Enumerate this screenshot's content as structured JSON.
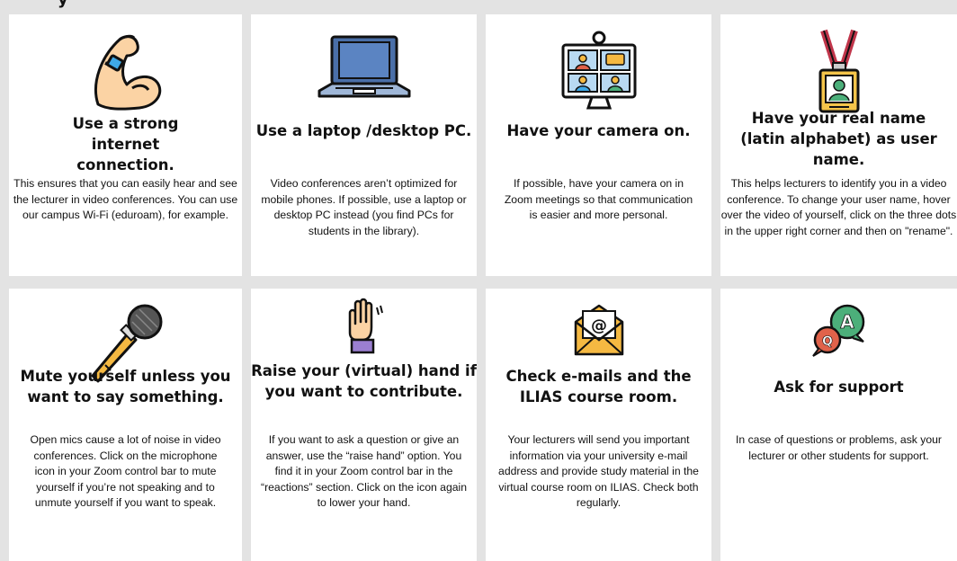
{
  "header": {
    "fragment": "y"
  },
  "cards": [
    {
      "title": "Use a strong internet connection.",
      "body": "This ensures that you can easily hear and see the lecturer in video conferences. You can use our campus Wi-Fi (eduroam), for example.",
      "icon": "flexed-arm-icon"
    },
    {
      "title": "Use a laptop /desktop PC.",
      "body": "Video conferences aren’t optimized for mobile phones. If possible, use a laptop or desktop PC instead (you find PCs for students in the library).",
      "icon": "laptop-icon"
    },
    {
      "title": "Have your camera on.",
      "body": "If possible, have your camera on in Zoom meetings so that communication is easier and more personal.",
      "icon": "video-conference-monitor-icon"
    },
    {
      "title": "Have your real name (latin alphabet) as user name.",
      "body": "This helps lecturers to identify you in a video conference. To change your user name, hover over the video of yourself, click on the three dots in the upper right corner and then on \"rename\".",
      "icon": "id-badge-icon"
    },
    {
      "title": "Mute yourself unless you want to say something.",
      "body": "Open mics cause a lot of noise in video conferences. Click on the microphone icon in your Zoom control bar to mute yourself if you’re not speaking and to unmute yourself if you want to speak.",
      "icon": "microphone-icon"
    },
    {
      "title": "Raise your (virtual) hand if you want to contribute.",
      "body": "If you want to ask a question or give an answer, use the “raise hand” option. You find it in your Zoom control bar in the “reactions” section. Click on the icon again to lower your hand.",
      "icon": "raised-hand-icon"
    },
    {
      "title": "Check e-mails and the  ILIAS course room.",
      "body": "Your lecturers will send you important information via your university e-mail address and provide study material in the virtual course room on ILIAS. Check both regularly.",
      "icon": "email-envelope-icon"
    },
    {
      "title": "Ask for support",
      "body": "In case of questions or problems, ask your lecturer or other students for support.",
      "icon": "chat-bubbles-icon"
    }
  ]
}
